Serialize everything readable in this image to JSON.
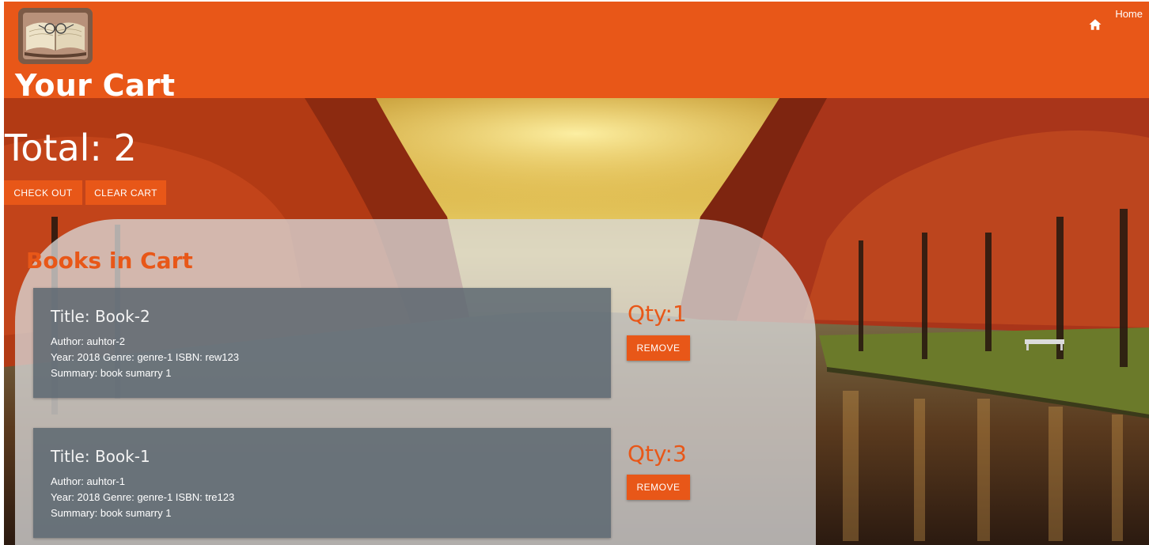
{
  "header": {
    "title": "Your Cart",
    "home_label": "Home",
    "logo_icon": "open-book-icon",
    "home_icon": "home-icon",
    "accent_color": "#e85718"
  },
  "cart": {
    "total_label": "Total: 2",
    "checkout_label": "CHECK OUT",
    "clear_label": "CLEAR CART"
  },
  "books_section": {
    "title": "Books in Cart",
    "items": [
      {
        "title": "Title: Book-2",
        "author": "Author: auhtor-2",
        "details": "Year: 2018 Genre: genre-1 ISBN: rew123",
        "summary": "Summary: book sumarry 1",
        "qty": "Qty:1",
        "remove_label": "REMOVE"
      },
      {
        "title": "Title: Book-1",
        "author": "Author: auhtor-1",
        "details": "Year: 2018 Genre: genre-1 ISBN: tre123",
        "summary": "Summary: book sumarry 1",
        "qty": "Qty:3",
        "remove_label": "REMOVE"
      }
    ]
  }
}
